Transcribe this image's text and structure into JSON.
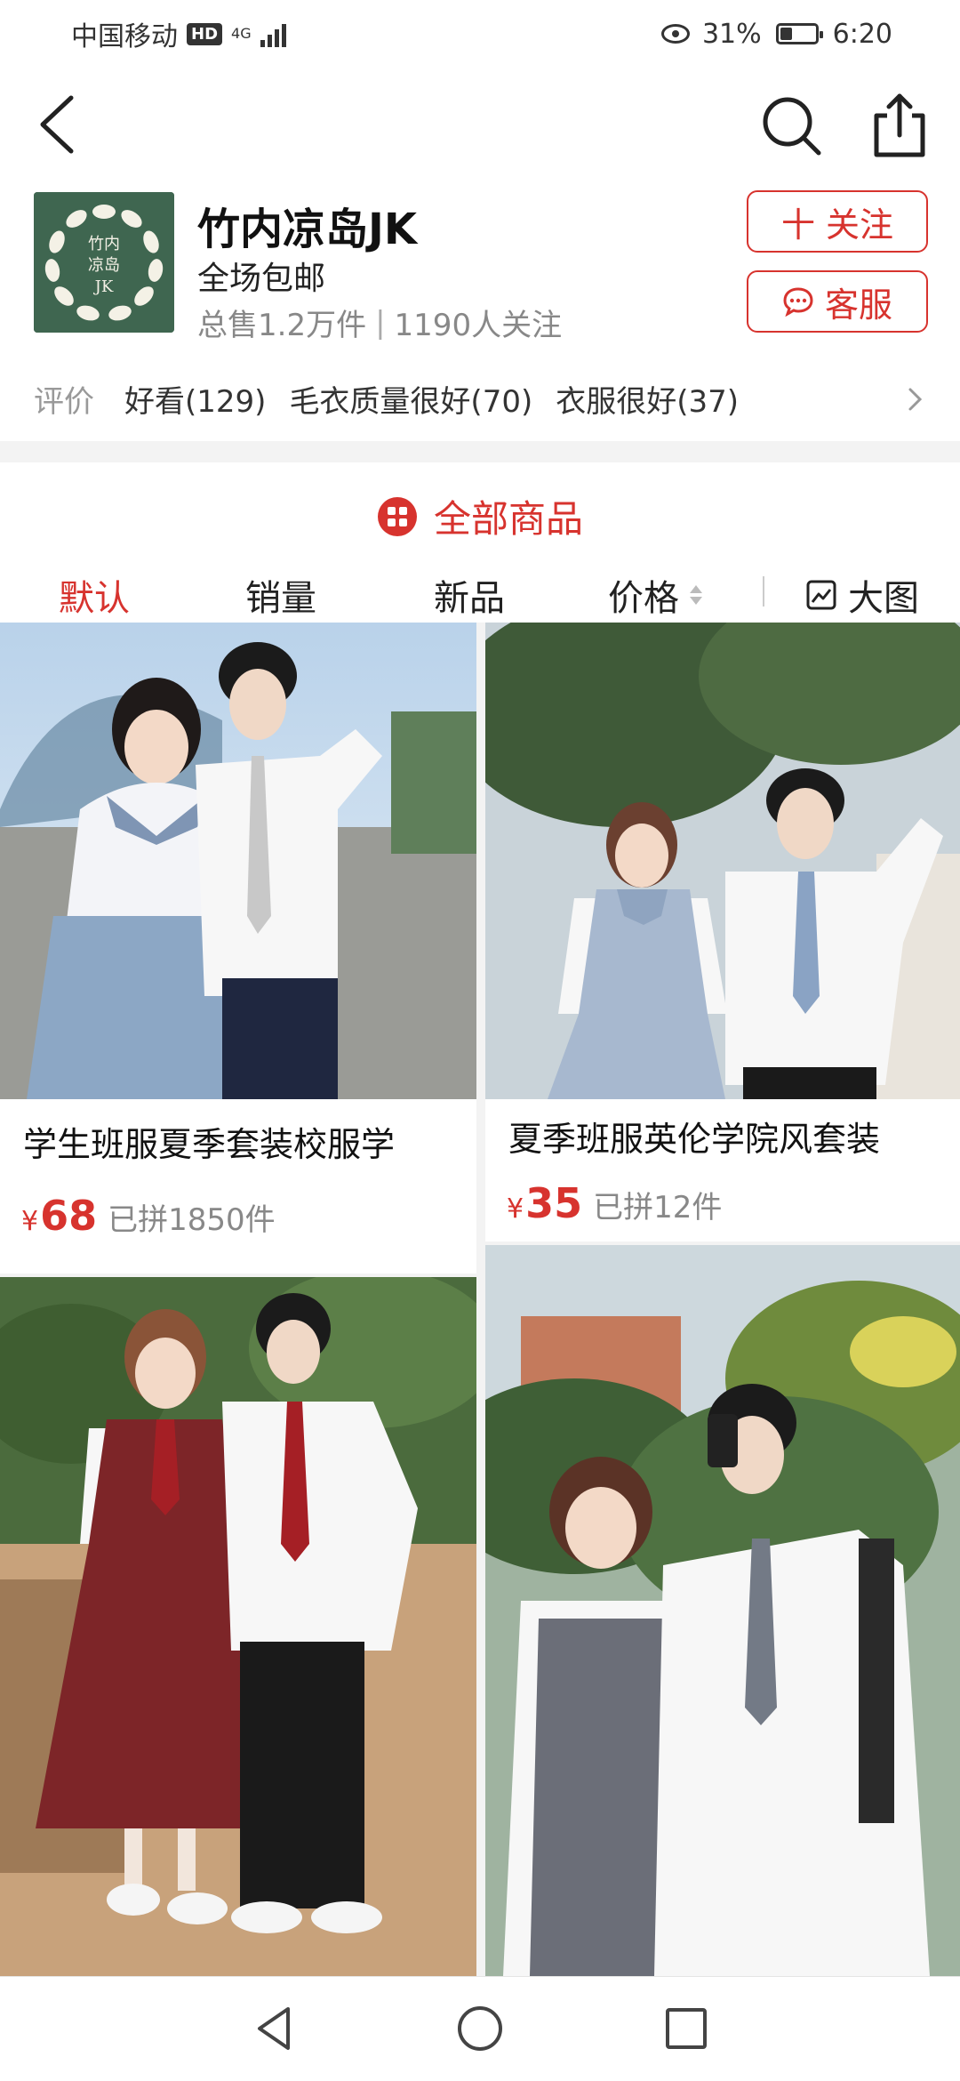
{
  "status_bar": {
    "carrier": "中国移动",
    "hd": "HD",
    "network": "4G",
    "battery_percent": "31%",
    "battery_level": 0.31,
    "time": "6:20"
  },
  "store": {
    "name": "竹内凉岛JK",
    "shipping": "全场包邮",
    "sales": "总售1.2万件",
    "followers": "1190人关注",
    "follow_label": "十 关注",
    "service_label": "客服",
    "logo_text": "竹内凉岛JK"
  },
  "reviews": {
    "label": "评价",
    "tags": [
      "好看(129)",
      "毛衣质量很好(70)",
      "衣服很好(37)"
    ]
  },
  "products_section": {
    "title": "全部商品",
    "sort": {
      "default": "默认",
      "sales": "销量",
      "new": "新品",
      "price": "价格",
      "view": "大图"
    }
  },
  "products": [
    {
      "title": "学生班服夏季套装校服学",
      "currency": "¥",
      "price": "68",
      "sold": "已拼1850件"
    },
    {
      "title": "夏季班服英伦学院风套装",
      "currency": "¥",
      "price": "35",
      "sold": "已拼12件"
    }
  ],
  "colors": {
    "accent": "#d7332e",
    "logo_green": "#3f6650"
  },
  "icons": [
    "back-icon",
    "search-icon",
    "share-icon",
    "chat-icon",
    "grid-icon",
    "chevron-right-icon",
    "image-view-icon",
    "nav-back-icon",
    "nav-home-icon",
    "nav-recent-icon"
  ]
}
